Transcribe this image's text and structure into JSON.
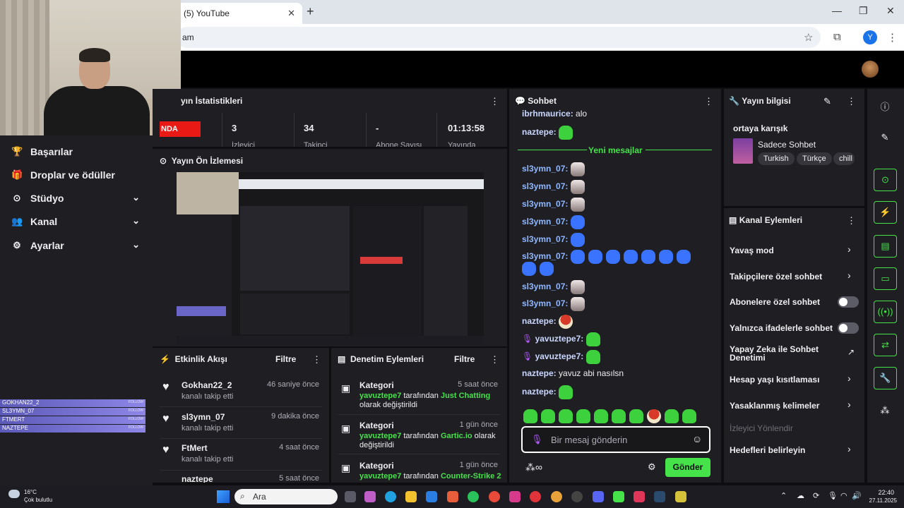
{
  "browser": {
    "tab_title": "(5) YouTube",
    "tab_close": "✕",
    "new_tab": "+",
    "url": "am",
    "profile_initial": "Y",
    "win_min": "—",
    "win_max": "❐",
    "win_close": "✕"
  },
  "sidebar": {
    "items": [
      {
        "icon": "trophy-icon",
        "glyph": "🏆",
        "label": "Başarılar"
      },
      {
        "icon": "gift-icon",
        "glyph": "🎁",
        "label": "Droplar ve ödüller"
      },
      {
        "icon": "studio-icon",
        "glyph": "⊙",
        "label": "Stüdyo"
      },
      {
        "icon": "channel-icon",
        "glyph": "👥",
        "label": "Kanal"
      },
      {
        "icon": "gear-icon",
        "glyph": "⚙",
        "label": "Ayarlar"
      }
    ],
    "chevron": "⌄",
    "followers": [
      "GOKHAN22_2",
      "SL3YMN_07",
      "FTMERT",
      "NAZTEPE"
    ],
    "follow_label": "FOLLOW"
  },
  "stats": {
    "title": "yın İstatistikleri",
    "live_label": "NDA",
    "values": [
      {
        "value": "3",
        "label": "İzleyici"
      },
      {
        "value": "34",
        "label": "Takipçi"
      },
      {
        "value": "-",
        "label": "Abone Sayısı"
      },
      {
        "value": "01:13:58",
        "label": "Yayında"
      }
    ]
  },
  "preview": {
    "title": "Yayın Ön İzlemesi"
  },
  "activity": {
    "title": "Etkinlik Akışı",
    "filter": "Filtre",
    "items": [
      {
        "name": "Gokhan22_2",
        "sub": "kanalı takip etti",
        "time": "46 saniye önce"
      },
      {
        "name": "sl3ymn_07",
        "sub": "kanalı takip etti",
        "time": "9 dakika önce"
      },
      {
        "name": "FtMert",
        "sub": "kanalı takip etti",
        "time": "4 saat önce"
      },
      {
        "name": "naztepe",
        "sub": "",
        "time": "5 saat önce"
      }
    ]
  },
  "moderation": {
    "title": "Denetim Eylemleri",
    "filter": "Filtre",
    "items": [
      {
        "title": "Kategori",
        "time": "5 saat önce",
        "user": "yavuztepe7",
        "mid": " tarafından ",
        "value": "Just Chatting",
        "tail": "olarak değiştirildi"
      },
      {
        "title": "Kategori",
        "time": "1 gün önce",
        "user": "yavuztepe7",
        "mid": " tarafından ",
        "value": "Gartic.io",
        "tail": "olarak değiştirildi"
      },
      {
        "title": "Kategori",
        "time": "1 gün önce",
        "user": "yavuztepe7",
        "mid": " tarafından ",
        "value": "Counter-Strike 2",
        "tail": ""
      }
    ]
  },
  "chat": {
    "title": "Sohbet",
    "new_messages": "Yeni mesajlar",
    "lines": [
      {
        "user": "ibrhmaurice:",
        "text": "alo"
      },
      {
        "user": "naztepe:",
        "text": ""
      },
      {
        "user": "sl3ymn_07:",
        "text": ""
      },
      {
        "user": "sl3ymn_07:",
        "text": ""
      },
      {
        "user": "sl3ymn_07:",
        "text": ""
      },
      {
        "user": "sl3ymn_07:",
        "text": ""
      },
      {
        "user": "sl3ymn_07:",
        "text": ""
      },
      {
        "user": "sl3ymn_07:",
        "text": ""
      },
      {
        "user": "sl3ymn_07:",
        "text": ""
      },
      {
        "user": "sl3ymn_07:",
        "text": ""
      },
      {
        "user": "naztepe:",
        "text": ""
      },
      {
        "user": "yavuztepe7:",
        "text": ""
      },
      {
        "user": "yavuztepe7:",
        "text": ""
      },
      {
        "user": "naztepe:",
        "text": "yavuz abi nasılsn"
      },
      {
        "user": "naztepe:",
        "text": ""
      }
    ],
    "input_placeholder": "Bir mesaj gönderin",
    "send_label": "Gönder"
  },
  "stream_info": {
    "title": "Yayın bilgisi",
    "stream_title": "ortaya karışık",
    "category": "Sadece Sohbet",
    "tags": [
      "Turkish",
      "Türkçe",
      "chill"
    ]
  },
  "channel_actions": {
    "title": "Kanal Eylemleri",
    "items": [
      {
        "label": "Yavaş mod",
        "control": "chevron"
      },
      {
        "label": "Takipçilere özel sohbet",
        "control": "chevron"
      },
      {
        "label": "Abonelere özel sohbet",
        "control": "toggle"
      },
      {
        "label": "Yalnızca ifadelerle sohbet",
        "control": "toggle"
      },
      {
        "label": "Yapay Zeka ile Sohbet Denetimi",
        "control": "external"
      },
      {
        "label": "Hesap yaşı kısıtlaması",
        "control": "chevron"
      },
      {
        "label": "Yasaklanmış kelimeler",
        "control": "chevron"
      },
      {
        "label": "İzleyici Yönlendir",
        "control": "none"
      },
      {
        "label": "Hedefleri belirleyin",
        "control": "chevron"
      }
    ]
  },
  "taskbar": {
    "weather_temp": "16°C",
    "weather_desc": "Çok bulutlu",
    "search": "Ara",
    "time": "22:40",
    "date": "27.11.2025"
  },
  "colors": {
    "accent": "#45e24a",
    "live": "#e91916",
    "panel": "#1f1f23",
    "background": "#0e0e10"
  }
}
